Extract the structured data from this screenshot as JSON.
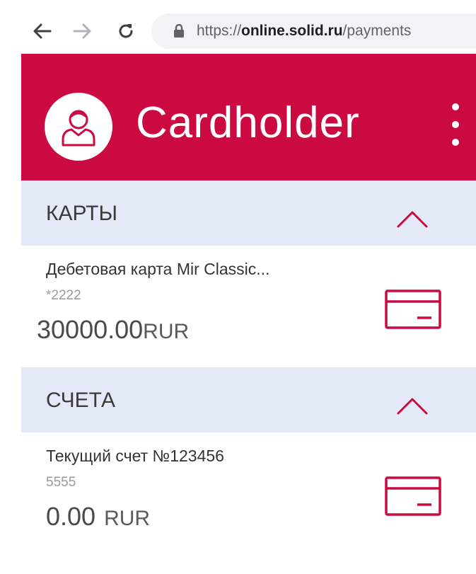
{
  "browser": {
    "url_scheme": "https://",
    "url_host": "online.solid.ru",
    "url_path": "/payments"
  },
  "header": {
    "title": "Cardholder",
    "brand_color": "#cc0a42"
  },
  "sections": [
    {
      "title": "КАРТЫ",
      "items": [
        {
          "name": "Дебетовая карта Mir Classic...",
          "number": "*2222",
          "amount": "30000.00",
          "currency": "RUR"
        }
      ]
    },
    {
      "title": "СЧЕТА",
      "items": [
        {
          "name": "Текущий счет №123456",
          "number": "5555",
          "amount": "0.00",
          "currency": "RUR"
        }
      ]
    }
  ],
  "icons": {
    "back": "arrow-left-icon",
    "forward": "arrow-right-icon",
    "reload": "reload-icon",
    "lock": "lock-icon",
    "avatar": "user-icon",
    "menu": "more-vertical-icon",
    "collapse": "chevron-up-icon",
    "card": "credit-card-icon"
  }
}
